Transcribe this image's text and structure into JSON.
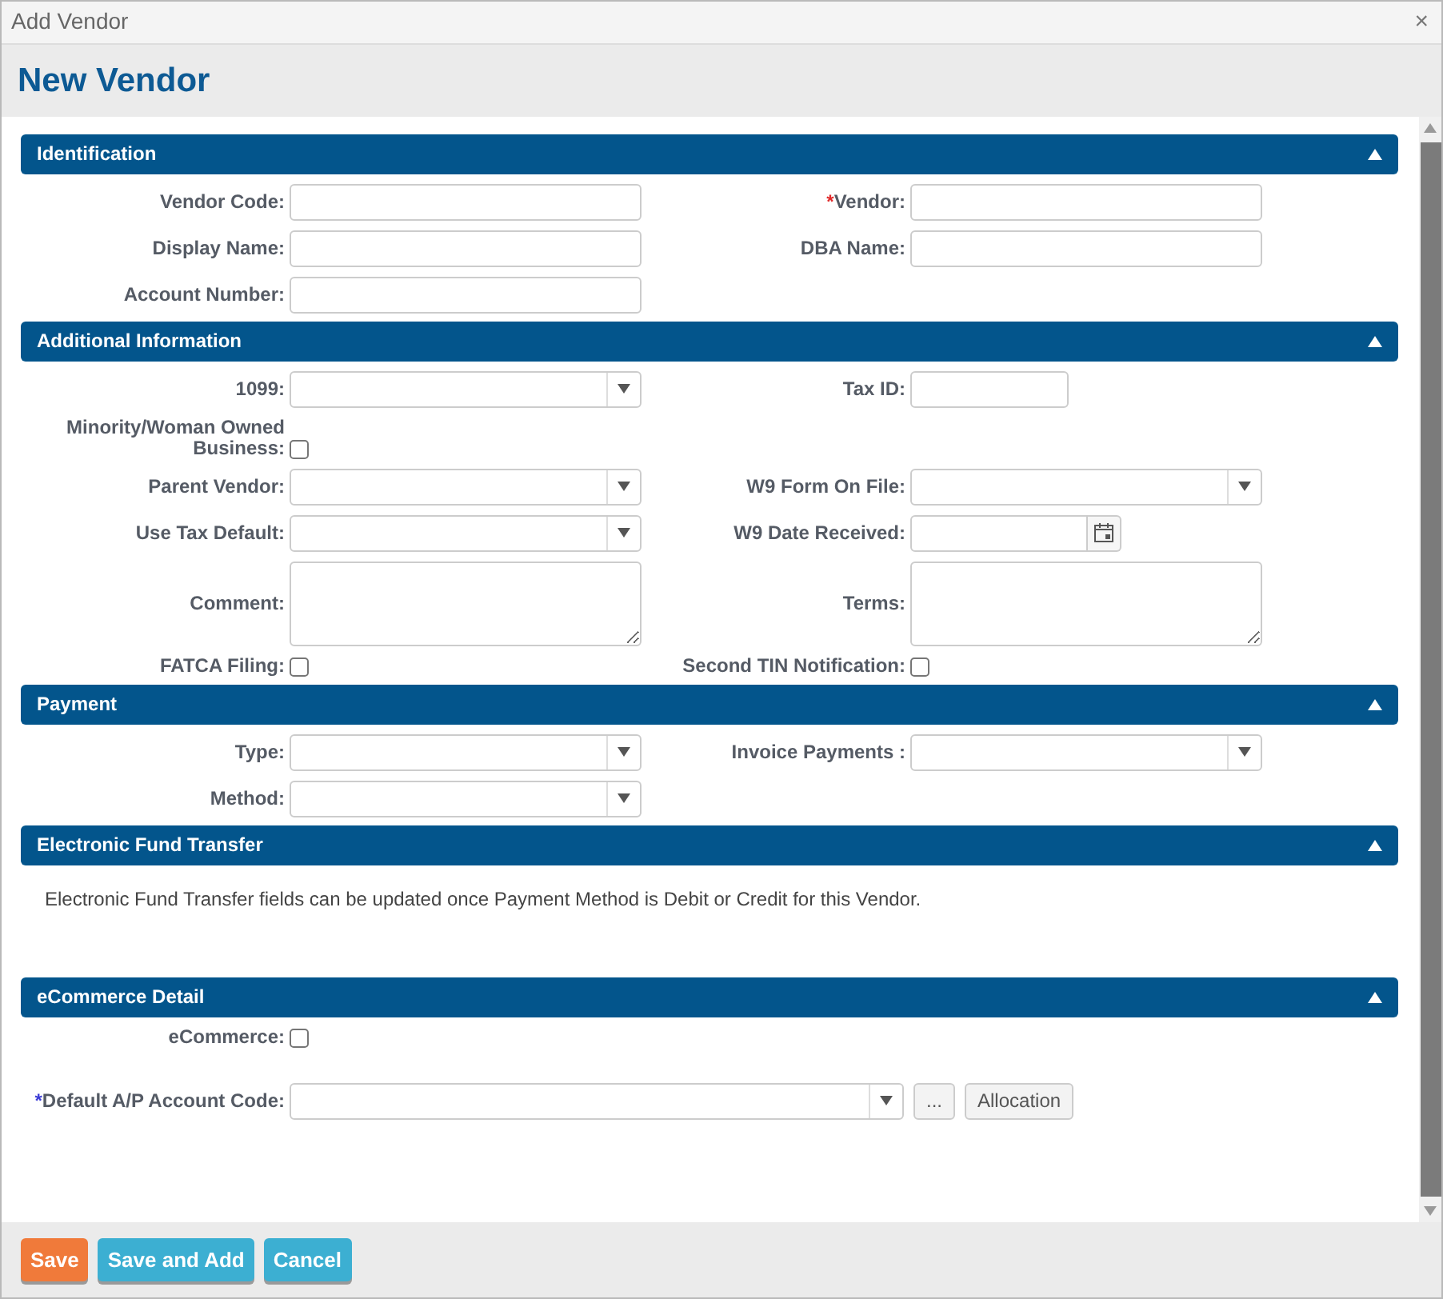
{
  "window": {
    "title": "Add Vendor",
    "close": "×"
  },
  "header": {
    "title": "New Vendor"
  },
  "sections": [
    {
      "title": "Identification",
      "expanded": true,
      "rows": [
        [
          {
            "kind": "text",
            "label": "Vendor Code:"
          },
          {
            "kind": "text",
            "label": "Vendor:",
            "asterisk": "*",
            "color": "#e02b2b"
          }
        ],
        [
          {
            "kind": "text",
            "label": "Display Name:"
          },
          {
            "kind": "text",
            "label": "DBA Name:"
          }
        ],
        [
          {
            "kind": "text",
            "label": "Account Number:"
          }
        ]
      ]
    },
    {
      "title": "Additional Information",
      "expanded": true,
      "rows": [
        [
          {
            "kind": "select",
            "label": "1099:"
          },
          {
            "kind": "short_text",
            "label": "Tax ID:"
          }
        ],
        [
          {
            "kind": "checkbox",
            "label": "Minority/Woman Owned Business:",
            "checked": false
          }
        ],
        [
          {
            "kind": "select",
            "label": "Parent Vendor:"
          },
          {
            "kind": "select",
            "label": "W9 Form On File:"
          }
        ],
        [
          {
            "kind": "select",
            "label": "Use Tax Default:"
          },
          {
            "kind": "date",
            "label": "W9 Date Received:"
          }
        ],
        [
          {
            "kind": "textarea",
            "label": "Comment:"
          },
          {
            "kind": "textarea",
            "label": "Terms:"
          }
        ],
        [
          {
            "kind": "checkbox",
            "label": "FATCA Filing:",
            "checked": false
          },
          {
            "kind": "checkbox",
            "label": "Second TIN Notification:",
            "checked": false
          }
        ]
      ]
    },
    {
      "title": "Payment",
      "expanded": true,
      "rows": [
        [
          {
            "kind": "select",
            "label": "Type:"
          },
          {
            "kind": "select",
            "label": "Invoice Payments :"
          }
        ],
        [
          {
            "kind": "select",
            "label": "Method:"
          }
        ]
      ]
    },
    {
      "title": "Electronic Fund Transfer",
      "expanded": true,
      "note": "Electronic Fund Transfer fields can be updated once Payment Method is Debit or Credit for this Vendor."
    },
    {
      "title": "eCommerce Detail",
      "expanded": true,
      "rows": [
        [
          {
            "kind": "checkbox",
            "label": "eCommerce:",
            "checked": false
          }
        ],
        [
          {
            "kind": "account",
            "label": "Default A/P Account Code:",
            "asterisk": "*",
            "color": "#3b3bd6",
            "buttons": [
              "...",
              "Allocation"
            ]
          }
        ]
      ]
    }
  ],
  "footer": {
    "buttons": [
      {
        "label": "Save",
        "kind": "primary"
      },
      {
        "label": "Save and Add",
        "kind": "secondary"
      },
      {
        "label": "Cancel",
        "kind": "secondary"
      }
    ]
  }
}
